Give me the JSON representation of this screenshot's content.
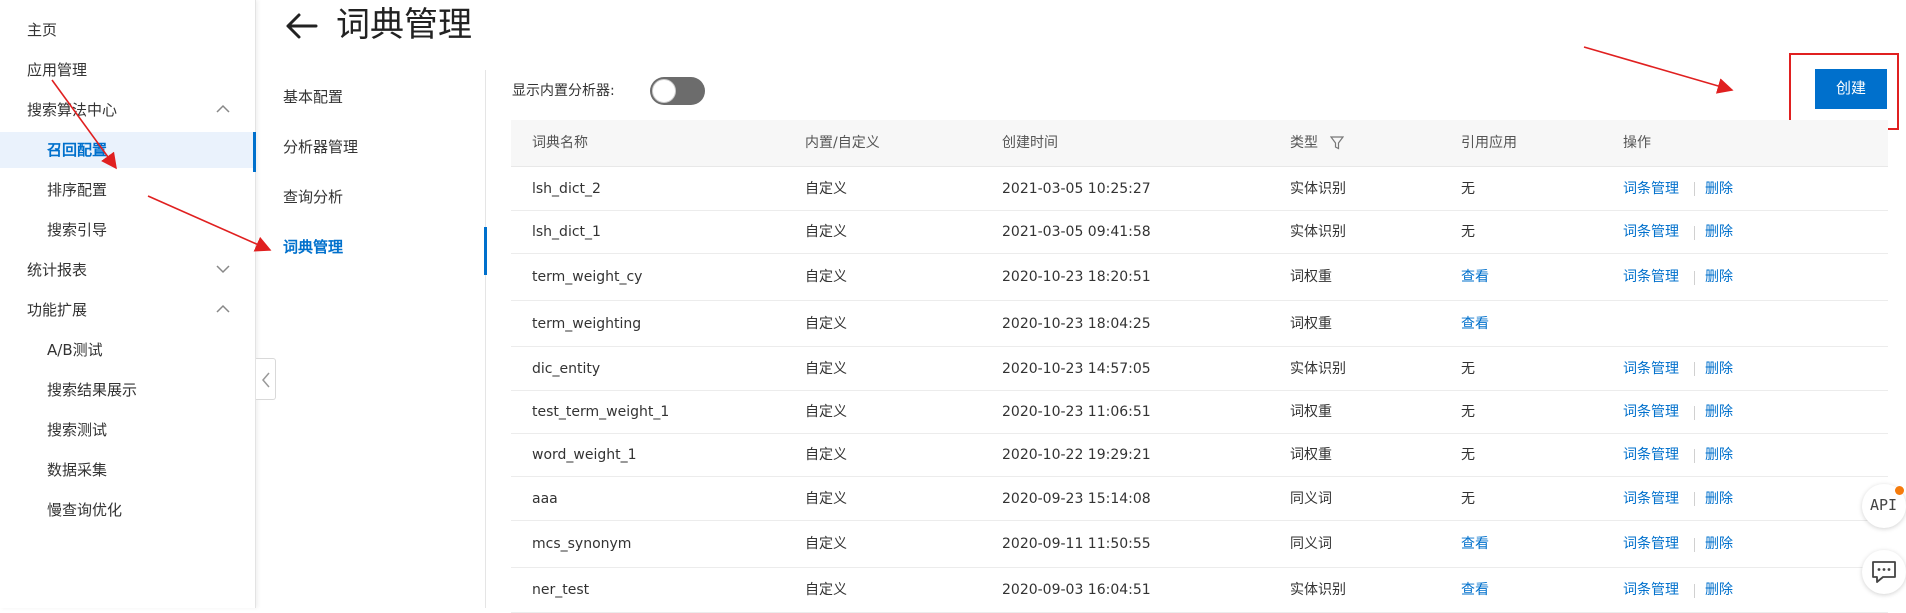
{
  "sidebar": {
    "items": [
      {
        "label": "主页"
      },
      {
        "label": "应用管理"
      },
      {
        "label": "搜索算法中心"
      },
      {
        "label": "召回配置"
      },
      {
        "label": "排序配置"
      },
      {
        "label": "搜索引导"
      },
      {
        "label": "统计报表"
      },
      {
        "label": "功能扩展"
      },
      {
        "label": "A/B测试"
      },
      {
        "label": "搜索结果展示"
      },
      {
        "label": "搜索测试"
      },
      {
        "label": "数据采集"
      },
      {
        "label": "慢查询优化"
      }
    ],
    "active_item": "召回配置"
  },
  "header": {
    "title": "词典管理"
  },
  "submenu": {
    "items": [
      {
        "label": "基本配置"
      },
      {
        "label": "分析器管理"
      },
      {
        "label": "查询分析"
      },
      {
        "label": "词典管理"
      }
    ],
    "active_item": "词典管理"
  },
  "toolbar": {
    "toggle_label": "显示内置分析器:",
    "toggle_on": false,
    "create_label": "创建"
  },
  "table": {
    "columns": [
      "词典名称",
      "内置/自定义",
      "创建时间",
      "类型",
      "引用应用",
      "操作"
    ],
    "rows": [
      {
        "name": "lsh_dict_2",
        "kind": "自定义",
        "created": "2021-03-05 10:25:27",
        "type": "实体识别",
        "ref": "无",
        "ref_link": false,
        "op1": "词条管理",
        "op2": "删除"
      },
      {
        "name": "lsh_dict_1",
        "kind": "自定义",
        "created": "2021-03-05 09:41:58",
        "type": "实体识别",
        "ref": "无",
        "ref_link": false,
        "op1": "词条管理",
        "op2": "删除"
      },
      {
        "name": "term_weight_cy",
        "kind": "自定义",
        "created": "2020-10-23 18:20:51",
        "type": "词权重",
        "ref": "查看",
        "ref_link": true,
        "op1": "词条管理",
        "op2": "删除"
      },
      {
        "name": "term_weighting",
        "kind": "自定义",
        "created": "2020-10-23 18:04:25",
        "type": "词权重",
        "ref": "查看",
        "ref_link": true,
        "op1": "",
        "op2": ""
      },
      {
        "name": "dic_entity",
        "kind": "自定义",
        "created": "2020-10-23 14:57:05",
        "type": "实体识别",
        "ref": "无",
        "ref_link": false,
        "op1": "词条管理",
        "op2": "删除"
      },
      {
        "name": "test_term_weight_1",
        "kind": "自定义",
        "created": "2020-10-23 11:06:51",
        "type": "词权重",
        "ref": "无",
        "ref_link": false,
        "op1": "词条管理",
        "op2": "删除"
      },
      {
        "name": "word_weight_1",
        "kind": "自定义",
        "created": "2020-10-22 19:29:21",
        "type": "词权重",
        "ref": "无",
        "ref_link": false,
        "op1": "词条管理",
        "op2": "删除"
      },
      {
        "name": "aaa",
        "kind": "自定义",
        "created": "2020-09-23 15:14:08",
        "type": "同义词",
        "ref": "无",
        "ref_link": false,
        "op1": "词条管理",
        "op2": "删除"
      },
      {
        "name": "mcs_synonym",
        "kind": "自定义",
        "created": "2020-09-11 11:50:55",
        "type": "同义词",
        "ref": "查看",
        "ref_link": true,
        "op1": "词条管理",
        "op2": "删除"
      },
      {
        "name": "ner_test",
        "kind": "自定义",
        "created": "2020-09-03 16:04:51",
        "type": "实体识别",
        "ref": "查看",
        "ref_link": true,
        "op1": "词条管理",
        "op2": "删除"
      }
    ]
  },
  "floating": {
    "api_label": "API"
  },
  "colors": {
    "accent": "#0070cc",
    "annotation": "#e02020",
    "notification": "#f57b0c"
  },
  "icons": {
    "back": "arrow-left-icon",
    "filter": "filter-icon",
    "chat": "chat-icon",
    "collapse": "chevron-left-icon"
  }
}
